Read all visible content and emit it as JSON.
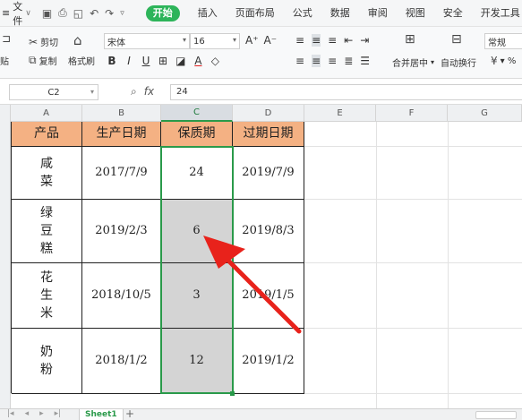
{
  "menubar": {
    "file_label": "文件",
    "tabs": [
      "开始",
      "插入",
      "页面布局",
      "公式",
      "数据",
      "审阅",
      "视图",
      "安全",
      "开发工具"
    ],
    "active_tab": "开始"
  },
  "ribbon": {
    "paste_label": "贴",
    "cut_label": "剪切",
    "copy_label": "复制",
    "format_painter_label": "格式刷",
    "font_name": "宋体",
    "font_size": "16",
    "merge_label": "合并居中",
    "wrap_label": "自动换行",
    "number_format": "常规"
  },
  "formula_bar": {
    "cell_ref": "C2",
    "fx_label": "fx",
    "value": "24"
  },
  "columns": [
    "A",
    "B",
    "C",
    "D",
    "E",
    "F",
    "G"
  ],
  "selected_column": "C",
  "table": {
    "headers": [
      "产品",
      "生产日期",
      "保质期",
      "过期日期"
    ],
    "rows": [
      {
        "product": [
          "咸",
          "菜"
        ],
        "production_date": "2017/7/9",
        "shelf_life": "24",
        "expiry_date": "2019/7/9"
      },
      {
        "product": [
          "绿",
          "豆",
          "糕"
        ],
        "production_date": "2019/2/3",
        "shelf_life": "6",
        "expiry_date": "2019/8/3"
      },
      {
        "product": [
          "花",
          "生",
          "米"
        ],
        "production_date": "2018/10/5",
        "shelf_life": "3",
        "expiry_date": "2019/1/5"
      },
      {
        "product": [
          "奶",
          "粉"
        ],
        "production_date": "2018/1/2",
        "shelf_life": "12",
        "expiry_date": "2019/1/2"
      }
    ]
  },
  "sheet": {
    "tab_label": "Sheet1",
    "add_label": "+"
  },
  "colors": {
    "header_fill": "#f4b183",
    "selected_fill": "#d4d4d4",
    "selection_border": "#2a9a4a",
    "arrow": "#e8221b",
    "active_tab": "#2db45a"
  }
}
